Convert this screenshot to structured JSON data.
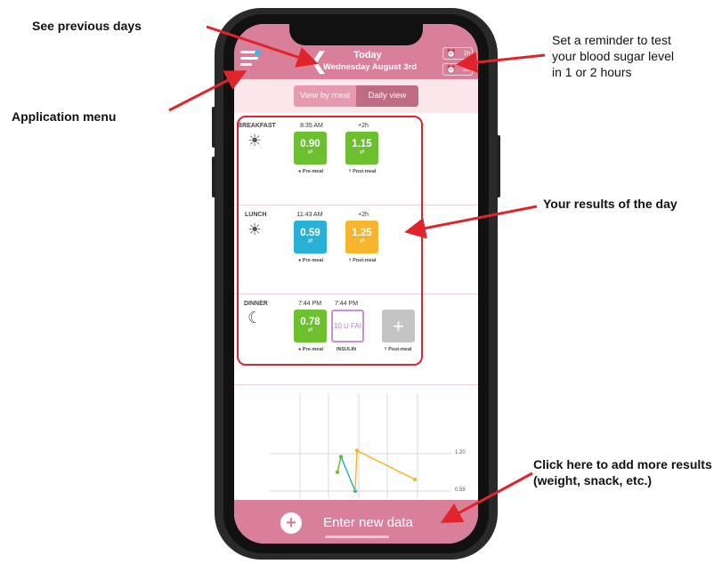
{
  "callouts": {
    "previous_days": "See previous days",
    "app_menu": "Application menu",
    "reminder": [
      "Set a reminder to test",
      "your blood sugar level",
      "in 1 or 2 hours"
    ],
    "results": "Your results of the day",
    "add_more": [
      "Click here to add more results",
      "(weight, snack, etc.)"
    ]
  },
  "header": {
    "title": "Today",
    "date": "Wednesday August 3rd",
    "alarm_1h": "1h",
    "alarm_2h": "2h"
  },
  "toggle": {
    "by_meal": "View by meal",
    "daily": "Daily view"
  },
  "meals": {
    "breakfast": {
      "label": "BREAKFAST",
      "pre_time": "8:35 AM",
      "post_time": "+2h",
      "pre_value": "0.90",
      "post_value": "1.15",
      "unit": "g/l",
      "pre_tag": "Pre-meal",
      "post_tag": "Post-meal"
    },
    "lunch": {
      "label": "LUNCH",
      "pre_time": "11:43 AM",
      "post_time": "+2h",
      "pre_value": "0.59",
      "post_value": "1.25",
      "unit": "g/l",
      "pre_tag": "Pre-meal",
      "post_tag": "Post-meal"
    },
    "dinner": {
      "label": "DINNER",
      "pre_time": "7:44 PM",
      "insulin_time": "7:44 PM",
      "pre_value": "0.78",
      "unit": "g/l",
      "insulin_value": "10 U FAI",
      "pre_tag": "Pre-meal",
      "insulin_tag": "INSULIN",
      "post_tag": "Post-meal"
    }
  },
  "colors": {
    "brand_pink": "#d97f9a",
    "green": "#6cbf2d",
    "blue": "#27b1d6",
    "orange": "#f7b52d",
    "purple": "#c68fd6",
    "callout_arrow": "#e0242b"
  },
  "chart_data": {
    "type": "line",
    "y_tick_labels": [
      "1.20",
      "0.59"
    ],
    "series": [
      {
        "color": "#6cbf2d",
        "values": [
          0.9,
          1.15
        ]
      },
      {
        "color": "#27b1d6",
        "values": [
          0.59
        ]
      },
      {
        "color": "#f7b52d",
        "values": [
          1.25,
          0.78
        ]
      }
    ]
  },
  "footer": {
    "enter_label": "Enter new data"
  },
  "icons": {
    "menu": "menu-icon",
    "back": "chevron-left-icon",
    "alarm": "alarm-clock-icon",
    "breakfast": "sunrise-icon",
    "lunch": "sun-icon",
    "dinner": "moon-icon",
    "add": "plus-icon"
  }
}
